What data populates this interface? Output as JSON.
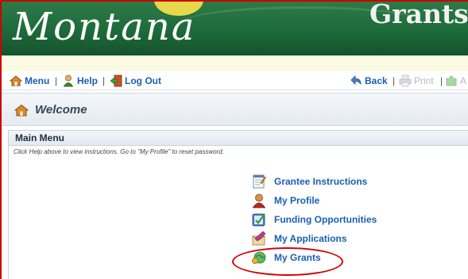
{
  "banner": {
    "logo_text": "Montana",
    "app_title": "Grants"
  },
  "toolbar": {
    "menu_label": "Menu",
    "help_label": "Help",
    "logout_label": "Log Out",
    "back_label": "Back",
    "print_label": "Print",
    "separator": "|",
    "last_item_partial": "A"
  },
  "welcome": {
    "title": "Welcome"
  },
  "main_menu": {
    "title": "Main Menu",
    "hint": "Click Help above to view instructions. Go to \"My Profile\" to reset password.",
    "items": [
      {
        "label": "Grantee Instructions",
        "icon": "instructions-notepad-icon"
      },
      {
        "label": "My Profile",
        "icon": "user-profile-icon"
      },
      {
        "label": "Funding Opportunities",
        "icon": "funding-opportunities-icon"
      },
      {
        "label": "My Applications",
        "icon": "applications-icon"
      },
      {
        "label": "My Grants",
        "icon": "grants-icon"
      }
    ]
  },
  "colors": {
    "link": "#1a5fb4",
    "banner_green": "#1d6a3a",
    "highlight_red": "#d40000"
  }
}
